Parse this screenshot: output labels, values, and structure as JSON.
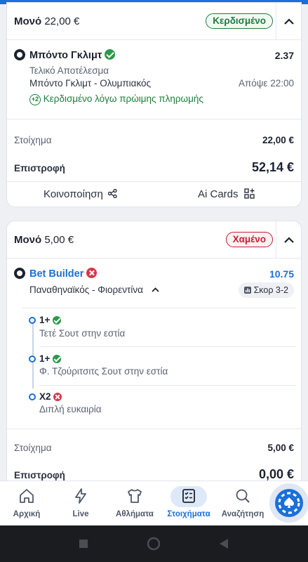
{
  "bet1": {
    "type": "Μονό",
    "amount": "22,00 €",
    "status": "Κερδισμένο",
    "selection": {
      "team": "Μπόντο Γκλιμτ",
      "odds": "2.37",
      "market": "Τελικό Αποτέλεσμα",
      "match": "Μπόντο Γκλιμτ - Ολυμπιακός",
      "time": "Απόψε 22:00",
      "early_payout": "Κερδισμένο λόγω πρώιμης πληρωμής",
      "early_icon": "+2"
    },
    "stake_label": "Στοίχημα",
    "stake_value": "22,00 €",
    "return_label": "Επιστροφή",
    "return_value": "52,14 €",
    "share_label": "Κοινοποίηση",
    "ai_label": "Ai Cards"
  },
  "bet2": {
    "type": "Μονό",
    "amount": "5,00 €",
    "status": "Χαμένο",
    "builder": {
      "title": "Bet Builder",
      "odds": "10.75",
      "match": "Παναθηναϊκός - Φιορεντίνα",
      "score": "Σκορ 3-2"
    },
    "legs": [
      {
        "pick": "1+",
        "desc": "Τετέ Σουτ στην εστία",
        "result": "won"
      },
      {
        "pick": "1+",
        "desc": "Φ. Τζούριτσιτς Σουτ στην εστία",
        "result": "won"
      },
      {
        "pick": "Χ2",
        "desc": "Διπλή ευκαιρία",
        "result": "lost"
      }
    ],
    "stake_label": "Στοίχημα",
    "stake_value": "5,00 €",
    "return_label": "Επιστροφή",
    "return_value": "0,00 €"
  },
  "nav": {
    "items": [
      {
        "label": "Αρχική",
        "icon": "home-icon"
      },
      {
        "label": "Live",
        "icon": "lightning-icon"
      },
      {
        "label": "Αθλήματα",
        "icon": "shirt-icon"
      },
      {
        "label": "Στοιχήματα",
        "icon": "betslip-icon"
      },
      {
        "label": "Αναζήτηση",
        "icon": "search-icon"
      }
    ],
    "active": "Στοιχήματα"
  },
  "colors": {
    "accent": "#1b6fd8",
    "won": "#1e7d3a",
    "lost": "#c42033"
  }
}
